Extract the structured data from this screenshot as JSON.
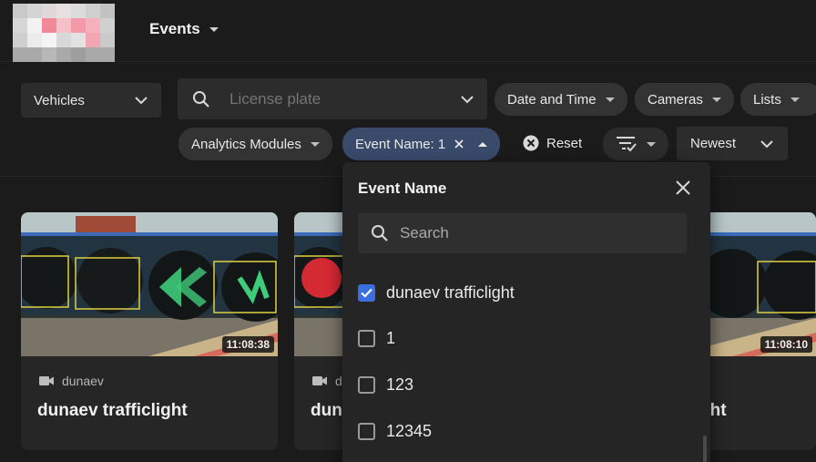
{
  "header": {
    "title": "Events"
  },
  "filters": {
    "object_type": "Vehicles",
    "license_placeholder": "License plate",
    "date_time": "Date and Time",
    "cameras": "Cameras",
    "lists": "Lists",
    "analytics": "Analytics Modules",
    "event_name_chip": "Event Name: 1",
    "reset": "Reset",
    "sort": "Newest"
  },
  "dropdown": {
    "title": "Event Name",
    "search_placeholder": "Search",
    "options": [
      {
        "label": "dunaev trafficlight",
        "checked": true
      },
      {
        "label": "1",
        "checked": false
      },
      {
        "label": "123",
        "checked": false
      },
      {
        "label": "12345",
        "checked": false
      }
    ]
  },
  "cards": [
    {
      "time": "11:08:38",
      "camera": "dunaev",
      "title": "dunaev trafficlight"
    },
    {
      "time": "",
      "camera": "d",
      "title": "duna"
    },
    {
      "time": "11:08:10",
      "camera": "",
      "title": "ght"
    }
  ],
  "colors": {
    "accent": "#3b6fe0",
    "chip_active": "#3a4a6b",
    "bbox": "#e0d040"
  }
}
